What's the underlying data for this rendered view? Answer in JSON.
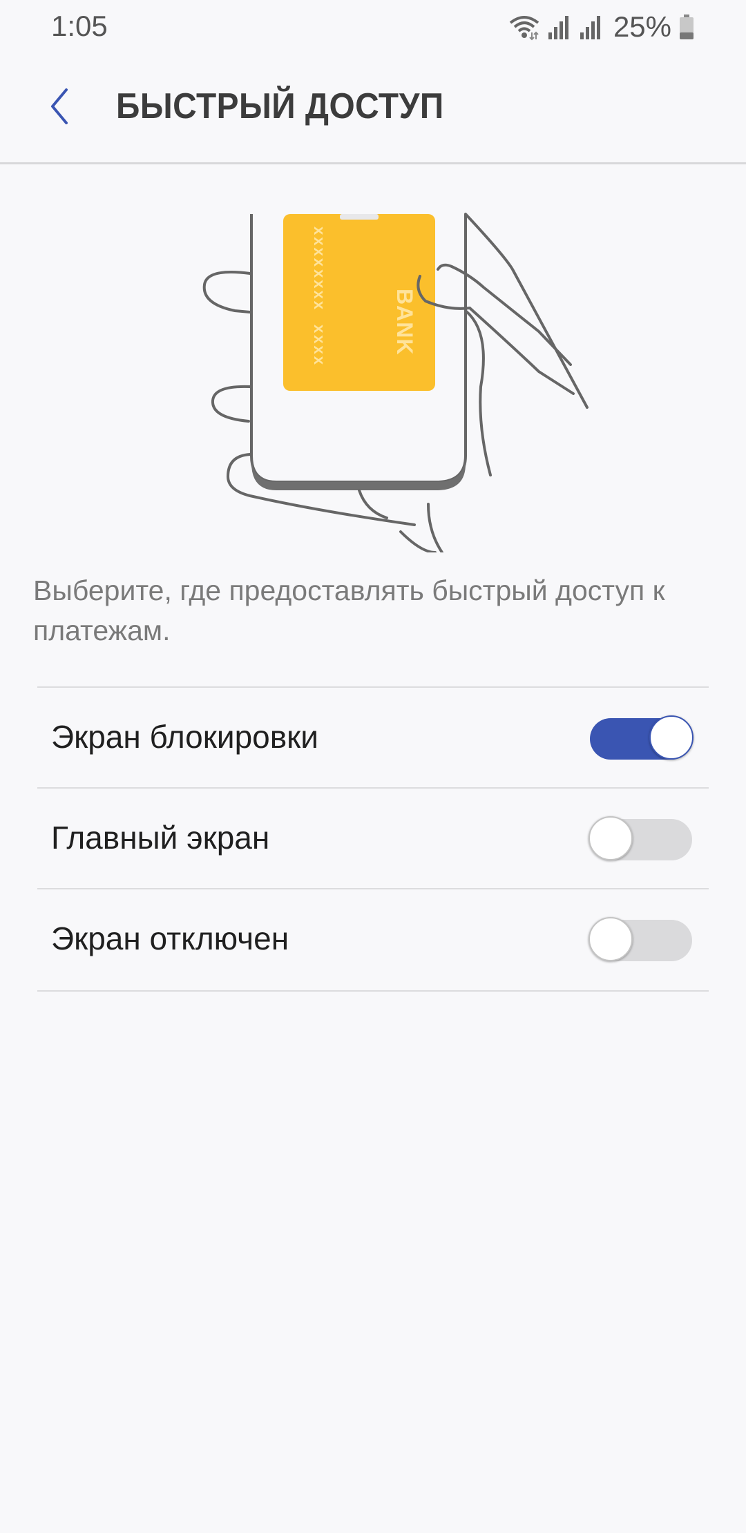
{
  "status_bar": {
    "time": "1:05",
    "battery_percent": "25%",
    "icons": [
      "wifi-icon",
      "signal-icon",
      "signal-icon",
      "battery-icon"
    ]
  },
  "header": {
    "back_icon": "chevron-left-icon",
    "title": "БЫСТРЫЙ ДОСТУП"
  },
  "illustration": {
    "card_text": "BANK",
    "card_number_groups": [
      "xxxx",
      "xxxx",
      "xxxx"
    ],
    "card_color": "#fbbf2c"
  },
  "description": "Выберите, где предоставлять быстрый доступ к платежам.",
  "options": [
    {
      "label": "Экран блокировки",
      "enabled": true
    },
    {
      "label": "Главный экран",
      "enabled": false
    },
    {
      "label": "Экран отключен",
      "enabled": false
    }
  ],
  "colors": {
    "accent": "#3a55b2",
    "toggle_off": "#dadadc",
    "background": "#f8f8fa"
  }
}
